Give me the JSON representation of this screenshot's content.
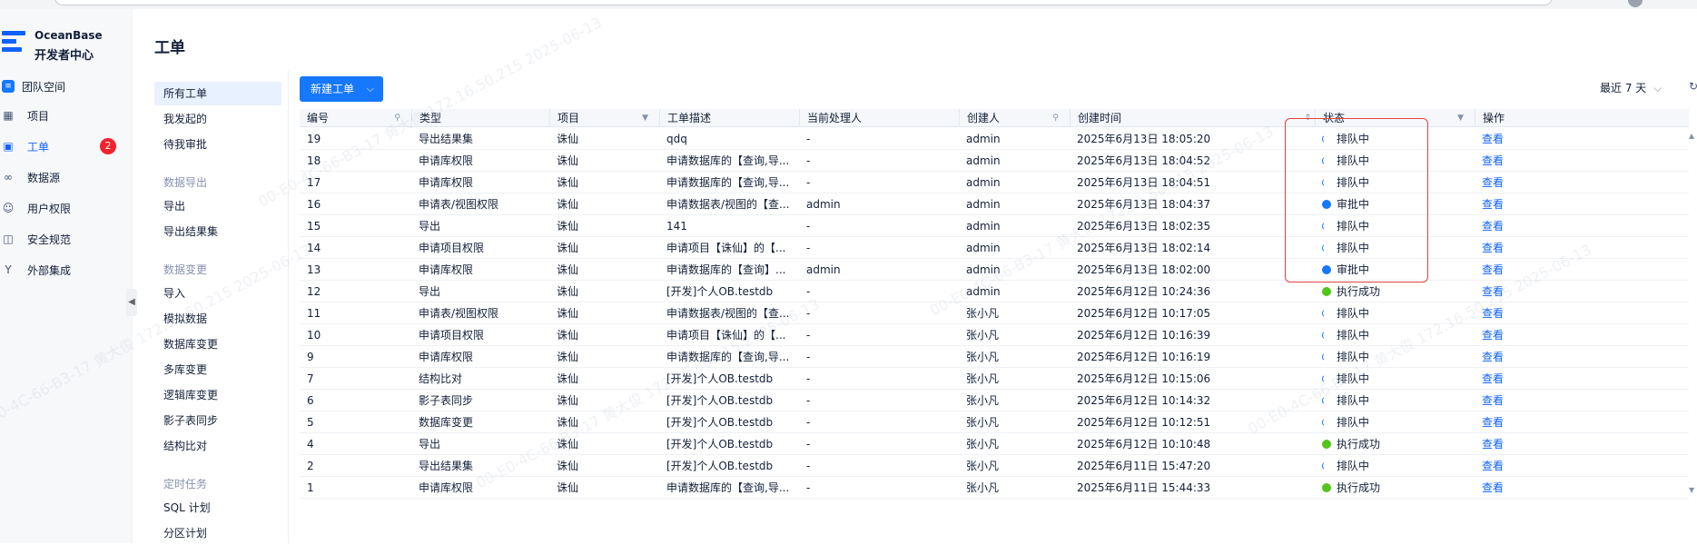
{
  "brand": {
    "name_line1": "OceanBase",
    "name_line2": "开发者中心"
  },
  "team": {
    "label": "团队空间"
  },
  "nav": [
    {
      "label": "项目",
      "icon": "grid-icon"
    },
    {
      "label": "工单",
      "icon": "ticket-icon",
      "active": true,
      "badge": "2"
    },
    {
      "label": "数据源",
      "icon": "link-icon"
    },
    {
      "label": "用户权限",
      "icon": "user-icon"
    },
    {
      "label": "安全规范",
      "icon": "shield-icon"
    },
    {
      "label": "外部集成",
      "icon": "plug-icon"
    }
  ],
  "page": {
    "title": "工单"
  },
  "submenu": {
    "items_top": [
      "所有工单",
      "我发起的",
      "待我审批"
    ],
    "group_export": "数据导出",
    "items_export": [
      "导出",
      "导出结果集"
    ],
    "group_change": "数据变更",
    "items_change": [
      "导入",
      "模拟数据",
      "数据库变更",
      "多库变更",
      "逻辑库变更",
      "影子表同步",
      "结构比对"
    ],
    "group_timer": "定时任务",
    "items_timer": [
      "SQL 计划",
      "分区计划"
    ]
  },
  "toolbar": {
    "new_button": "新建工单",
    "range": "最近 7 天"
  },
  "table": {
    "columns": [
      "编号",
      "类型",
      "项目",
      "工单描述",
      "当前处理人",
      "创建人",
      "创建时间",
      "状态",
      "操作"
    ],
    "rows": [
      {
        "id": "19",
        "type": "导出结果集",
        "project": "诛仙",
        "desc": "qdq",
        "handler": "-",
        "creator": "admin",
        "time": "2025年6月13日 18:05:20",
        "status": "排队中",
        "status_kind": "pending",
        "action": "查看"
      },
      {
        "id": "18",
        "type": "申请库权限",
        "project": "诛仙",
        "desc": "申请数据库的【查询,导...",
        "handler": "-",
        "creator": "admin",
        "time": "2025年6月13日 18:04:52",
        "status": "排队中",
        "status_kind": "pending",
        "action": "查看"
      },
      {
        "id": "17",
        "type": "申请库权限",
        "project": "诛仙",
        "desc": "申请数据库的【查询,导...",
        "handler": "-",
        "creator": "admin",
        "time": "2025年6月13日 18:04:51",
        "status": "排队中",
        "status_kind": "pending",
        "action": "查看"
      },
      {
        "id": "16",
        "type": "申请表/视图权限",
        "project": "诛仙",
        "desc": "申请数据表/视图的【查...",
        "handler": "admin",
        "creator": "admin",
        "time": "2025年6月13日 18:04:37",
        "status": "审批中",
        "status_kind": "approve",
        "action": "查看"
      },
      {
        "id": "15",
        "type": "导出",
        "project": "诛仙",
        "desc": "141",
        "handler": "-",
        "creator": "admin",
        "time": "2025年6月13日 18:02:35",
        "status": "排队中",
        "status_kind": "pending",
        "action": "查看"
      },
      {
        "id": "14",
        "type": "申请项目权限",
        "project": "诛仙",
        "desc": "申请项目【诛仙】的【...",
        "handler": "-",
        "creator": "admin",
        "time": "2025年6月13日 18:02:14",
        "status": "排队中",
        "status_kind": "pending",
        "action": "查看"
      },
      {
        "id": "13",
        "type": "申请库权限",
        "project": "诛仙",
        "desc": "申请数据库的【查询】...",
        "handler": "admin",
        "creator": "admin",
        "time": "2025年6月13日 18:02:00",
        "status": "审批中",
        "status_kind": "approve",
        "action": "查看"
      },
      {
        "id": "12",
        "type": "导出",
        "project": "诛仙",
        "desc": "[开发]个人OB.testdb",
        "handler": "-",
        "creator": "admin",
        "time": "2025年6月12日 10:24:36",
        "status": "执行成功",
        "status_kind": "success",
        "action": "查看"
      },
      {
        "id": "11",
        "type": "申请表/视图权限",
        "project": "诛仙",
        "desc": "申请数据表/视图的【查...",
        "handler": "-",
        "creator": "张小凡",
        "time": "2025年6月12日 10:17:05",
        "status": "排队中",
        "status_kind": "pending",
        "action": "查看"
      },
      {
        "id": "10",
        "type": "申请项目权限",
        "project": "诛仙",
        "desc": "申请项目【诛仙】的【...",
        "handler": "-",
        "creator": "张小凡",
        "time": "2025年6月12日 10:16:39",
        "status": "排队中",
        "status_kind": "pending",
        "action": "查看"
      },
      {
        "id": "9",
        "type": "申请库权限",
        "project": "诛仙",
        "desc": "申请数据库的【查询,导...",
        "handler": "-",
        "creator": "张小凡",
        "time": "2025年6月12日 10:16:19",
        "status": "排队中",
        "status_kind": "pending",
        "action": "查看"
      },
      {
        "id": "7",
        "type": "结构比对",
        "project": "诛仙",
        "desc": "[开发]个人OB.testdb",
        "handler": "-",
        "creator": "张小凡",
        "time": "2025年6月12日 10:15:06",
        "status": "排队中",
        "status_kind": "pending",
        "action": "查看"
      },
      {
        "id": "6",
        "type": "影子表同步",
        "project": "诛仙",
        "desc": "[开发]个人OB.testdb",
        "handler": "-",
        "creator": "张小凡",
        "time": "2025年6月12日 10:14:32",
        "status": "排队中",
        "status_kind": "pending",
        "action": "查看"
      },
      {
        "id": "5",
        "type": "数据库变更",
        "project": "诛仙",
        "desc": "[开发]个人OB.testdb",
        "handler": "-",
        "creator": "张小凡",
        "time": "2025年6月12日 10:12:51",
        "status": "排队中",
        "status_kind": "pending",
        "action": "查看"
      },
      {
        "id": "4",
        "type": "导出",
        "project": "诛仙",
        "desc": "[开发]个人OB.testdb",
        "handler": "-",
        "creator": "张小凡",
        "time": "2025年6月12日 10:10:48",
        "status": "执行成功",
        "status_kind": "success",
        "action": "查看"
      },
      {
        "id": "2",
        "type": "导出结果集",
        "project": "诛仙",
        "desc": "[开发]个人OB.testdb",
        "handler": "-",
        "creator": "张小凡",
        "time": "2025年6月11日 15:47:20",
        "status": "排队中",
        "status_kind": "pending",
        "action": "查看"
      },
      {
        "id": "1",
        "type": "申请库权限",
        "project": "诛仙",
        "desc": "申请数据库的【查询,导...",
        "handler": "-",
        "creator": "张小凡",
        "time": "2025年6月11日 15:44:33",
        "status": "执行成功",
        "status_kind": "success",
        "action": "查看"
      }
    ]
  },
  "watermark": [
    "00-E0-4C-66-B3-17 黄大俊 172.16.50.215 2025-06-13"
  ],
  "colors": {
    "primary": "#1677ff",
    "success": "#52c41a",
    "danger": "#f5222d",
    "highlight": "#e0443e"
  }
}
